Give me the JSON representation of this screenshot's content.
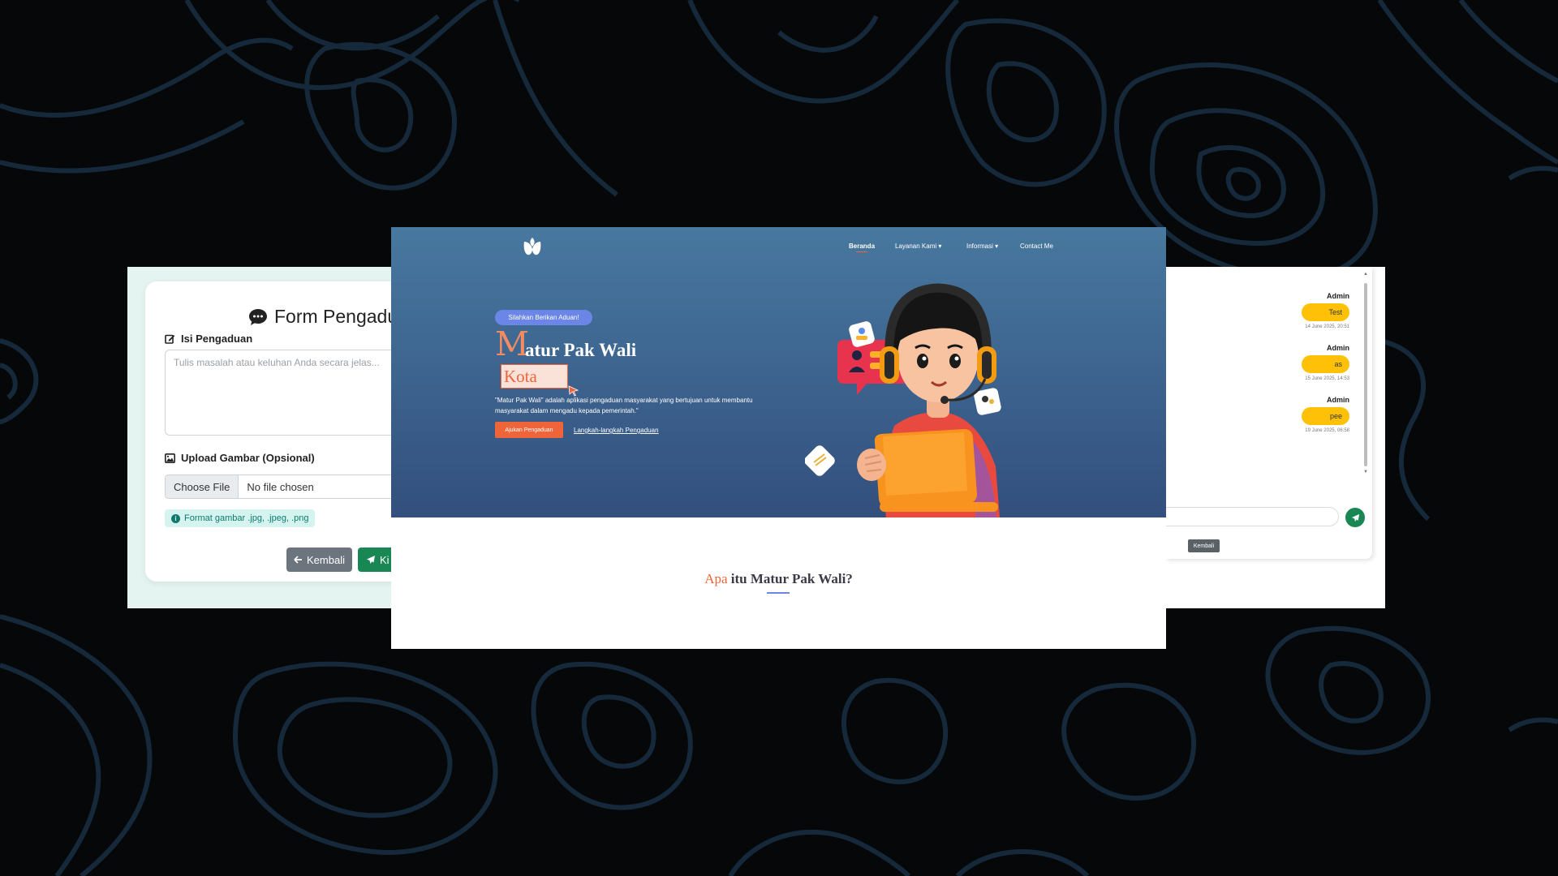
{
  "form": {
    "title": "Form Pengadu",
    "isi_label": "Isi Pengaduan",
    "textarea_placeholder": "Tulis masalah atau keluhan Anda secara jelas...",
    "upload_label": "Upload Gambar (Opsional)",
    "choose_file": "Choose File",
    "no_file": "No file chosen",
    "hint": "Format gambar .jpg, .jpeg, .png",
    "back_button": "Kembali",
    "send_button": "Ki"
  },
  "landing": {
    "nav": {
      "beranda": "Beranda",
      "layanan": "Layanan Kami",
      "informasi": "Informasi",
      "contact": "Contact Me"
    },
    "pill": "Silahkan Berikan Aduan!",
    "title_first_letter": "M",
    "title_rest": "atur Pak Wali",
    "title_highlight": "Kota",
    "description": "\"Matur Pak Wali\" adalah aplikasi pengaduan masyarakat yang bertujuan untuk membantu masyarakat dalam mengadu kepada pemerintah.\"",
    "cta_button": "Ajukan Pengaduan",
    "steps_link": "Langkah-langkah Pengaduan",
    "section_accent": "Apa",
    "section_rest": " itu Matur Pak Wali?"
  },
  "chat": {
    "messages": [
      {
        "sender": "Admin",
        "text": "Test",
        "time": "14 June 2025, 20:51"
      },
      {
        "sender": "Admin",
        "text": "as",
        "time": "15 June 2025, 14:53"
      },
      {
        "sender": "Admin",
        "text": "pee",
        "time": "19 June 2025, 06:58"
      }
    ],
    "back_button": "Kembali"
  },
  "colors": {
    "accent_orange": "#f0643a",
    "success_green": "#198754",
    "chat_bubble": "#ffc107",
    "pill_blue": "#6b86e6",
    "hero_top": "#48789f",
    "hero_bottom": "#334f7d"
  }
}
